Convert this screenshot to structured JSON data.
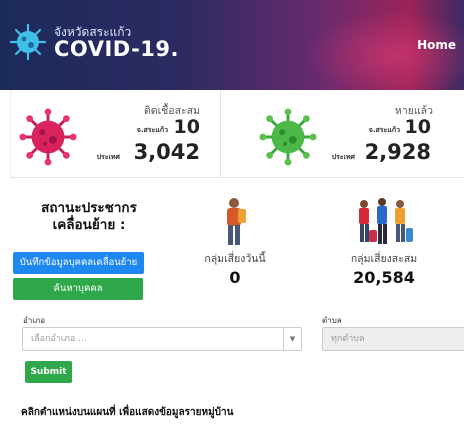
{
  "header": {
    "province": "จังหวัดสระแก้ว",
    "title": "COVID-19.",
    "nav_home": "Home"
  },
  "stats": {
    "infected": {
      "title": "ติดเชื้อสะสม",
      "province_label": "จ.สระแก้ว",
      "province_value": "10",
      "country_label": "ประเทศ",
      "country_value": "3,042",
      "icon": "red-virus-icon",
      "color": "#d8235d"
    },
    "recovered": {
      "title": "หายแล้ว",
      "province_label": "จ.สระแก้ว",
      "province_value": "10",
      "country_label": "ประเทศ",
      "country_value": "2,928",
      "icon": "green-virus-icon",
      "color": "#4cb848"
    }
  },
  "mobility": {
    "title_line1": "สถานะประชากร",
    "title_line2": "เคลื่อนย้าย :",
    "record_button": "บันทึกข้อมูลบุคคลเคลื่อนย้าย",
    "search_button": "ค้นหาบุคคล",
    "today": {
      "label": "กลุ่มเสี่ยงวันนี้",
      "value": "0"
    },
    "cumulative": {
      "label": "กลุ่มเสี่ยงสะสม",
      "value": "20,584"
    }
  },
  "filters": {
    "district_label": "อำเภอ",
    "district_placeholder": "เลือกอำเภอ ...",
    "subdistrict_label": "ตำบล",
    "subdistrict_placeholder": "ทุกตำบล",
    "submit": "Submit"
  },
  "map_note": "คลิกตำแหน่งบนแผนที่ เพื่อแสดงข้อมูลรายหมู่บ้าน",
  "colors": {
    "accent_blue": "#1e87f0",
    "accent_green": "#2ea84a"
  }
}
